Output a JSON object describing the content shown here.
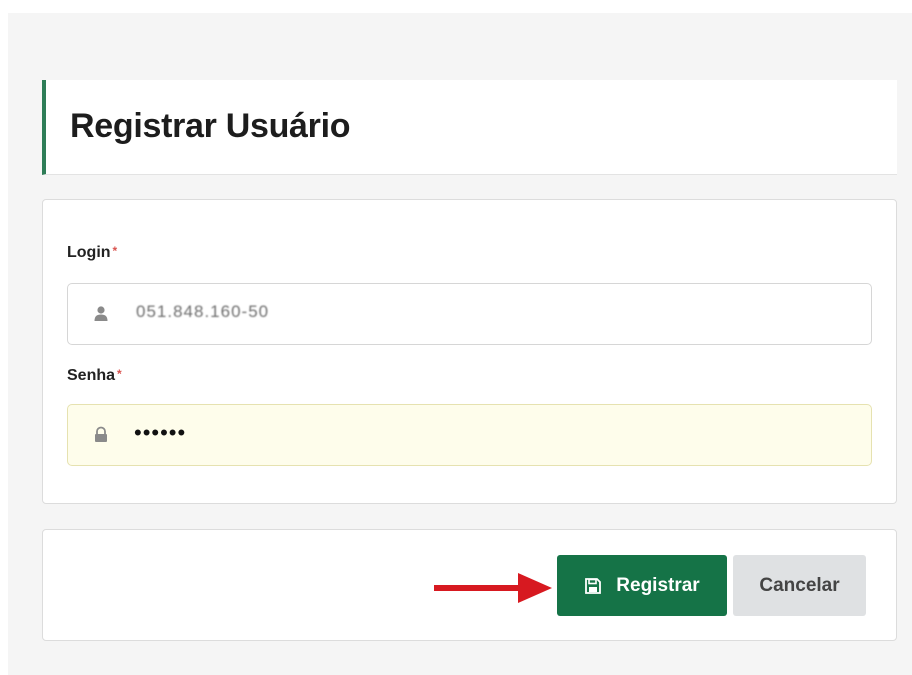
{
  "page": {
    "title": "Registrar Usuário"
  },
  "form": {
    "login": {
      "label": "Login",
      "required_mark": "*",
      "value": "051.848.160-50",
      "icon": "user-icon"
    },
    "password": {
      "label": "Senha",
      "required_mark": "*",
      "masked_value": "••••••",
      "icon": "lock-icon"
    }
  },
  "actions": {
    "submit_label": "Registrar",
    "submit_icon": "save-icon",
    "cancel_label": "Cancelar"
  },
  "annotation": {
    "arrow_color": "#d71920"
  },
  "colors": {
    "accent": "#2e7d57",
    "primary_button": "#157347",
    "required": "#d9534f",
    "autofill_bg": "#fefdeb"
  }
}
